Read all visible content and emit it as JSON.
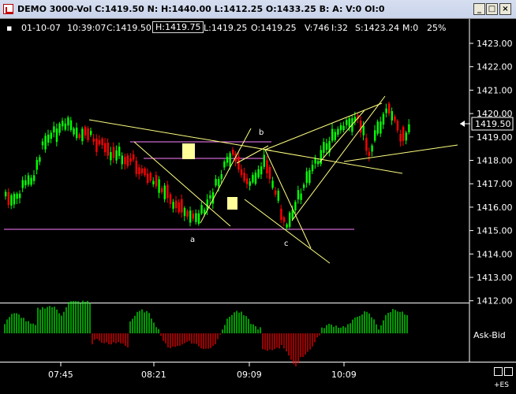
{
  "window": {
    "title": "DEMO 3000-Vol C:1419.50 N: H:1440.00 L:1412.25 O:1433.25 B: A: V:0 OI:0",
    "minimize": "_",
    "maximize": "□",
    "close": "×"
  },
  "info_bar": {
    "date": "01-10-07",
    "time": "10:39:07",
    "close": "C:1419.50",
    "high": "H:1419.75",
    "low": "L:1419.25",
    "open": "O:1419.25",
    "volume": "V:746",
    "ticks": "I:32",
    "s_value": "S:1423.24",
    "m_value": "M:0",
    "percent": "25%"
  },
  "price_axis": {
    "ticks": [
      "1423.00",
      "1422.00",
      "1421.00",
      "1420.00",
      "1419.00",
      "1418.00",
      "1417.00",
      "1416.00",
      "1415.00",
      "1414.00",
      "1413.00",
      "1412.00"
    ],
    "current_price": "1419.50"
  },
  "time_axis": {
    "ticks": [
      "07:45",
      "08:21",
      "09:09",
      "10:09"
    ]
  },
  "annotations": [
    "a",
    "b",
    "c"
  ],
  "indicator": {
    "label": "Ask-Bid"
  },
  "symbol_label": "+ES",
  "colors": {
    "up": "#00ff00",
    "down": "#ff0000",
    "trendline": "#ffff80",
    "level": "#ff80ff",
    "highlight": "#ffff99"
  }
}
